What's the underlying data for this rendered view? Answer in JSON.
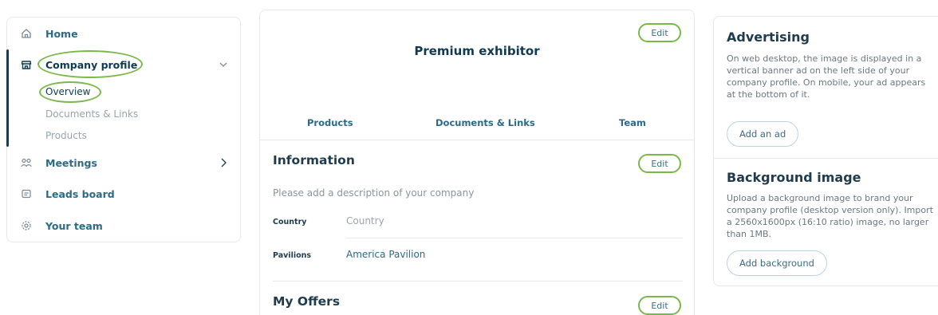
{
  "sidebar": {
    "items": [
      {
        "label": "Home",
        "icon": "home-icon"
      },
      {
        "label": "Company profile",
        "icon": "store-icon",
        "expanded": true,
        "children": [
          "Overview",
          "Documents & Links",
          "Products"
        ],
        "active_child": "Overview"
      },
      {
        "label": "Meetings",
        "icon": "people-icon"
      },
      {
        "label": "Leads board",
        "icon": "leads-icon"
      },
      {
        "label": "Your team",
        "icon": "gear-icon"
      }
    ]
  },
  "profile": {
    "title": "Premium exhibitor",
    "edit_label": "Edit",
    "tabs": [
      "Products",
      "Documents & Links",
      "Team"
    ],
    "information": {
      "title": "Information",
      "edit_label": "Edit",
      "description_placeholder": "Please add a description of your company",
      "fields": [
        {
          "label": "Country",
          "value": "Country",
          "is_placeholder": true
        },
        {
          "label": "Pavilions",
          "value": "America Pavilion",
          "is_placeholder": false
        }
      ]
    },
    "offers": {
      "title": "My Offers",
      "edit_label": "Edit"
    }
  },
  "advertising": {
    "title": "Advertising",
    "text": "On web desktop, the image is displayed in a vertical banner ad on the left side of your company profile. On mobile, your ad appears at the bottom of it.",
    "button": "Add an ad"
  },
  "background": {
    "title": "Background image",
    "text": "Upload a background image to brand your company profile (desktop version only). Import a 2560x1600px (16:10 ratio) image, no larger than 1MB.",
    "button": "Add background"
  },
  "colors": {
    "primary": "#0f3a52",
    "link": "#2c6a86",
    "muted": "#9aa4ab",
    "annotation": "#7bb84a",
    "border": "#e6e9ec"
  }
}
